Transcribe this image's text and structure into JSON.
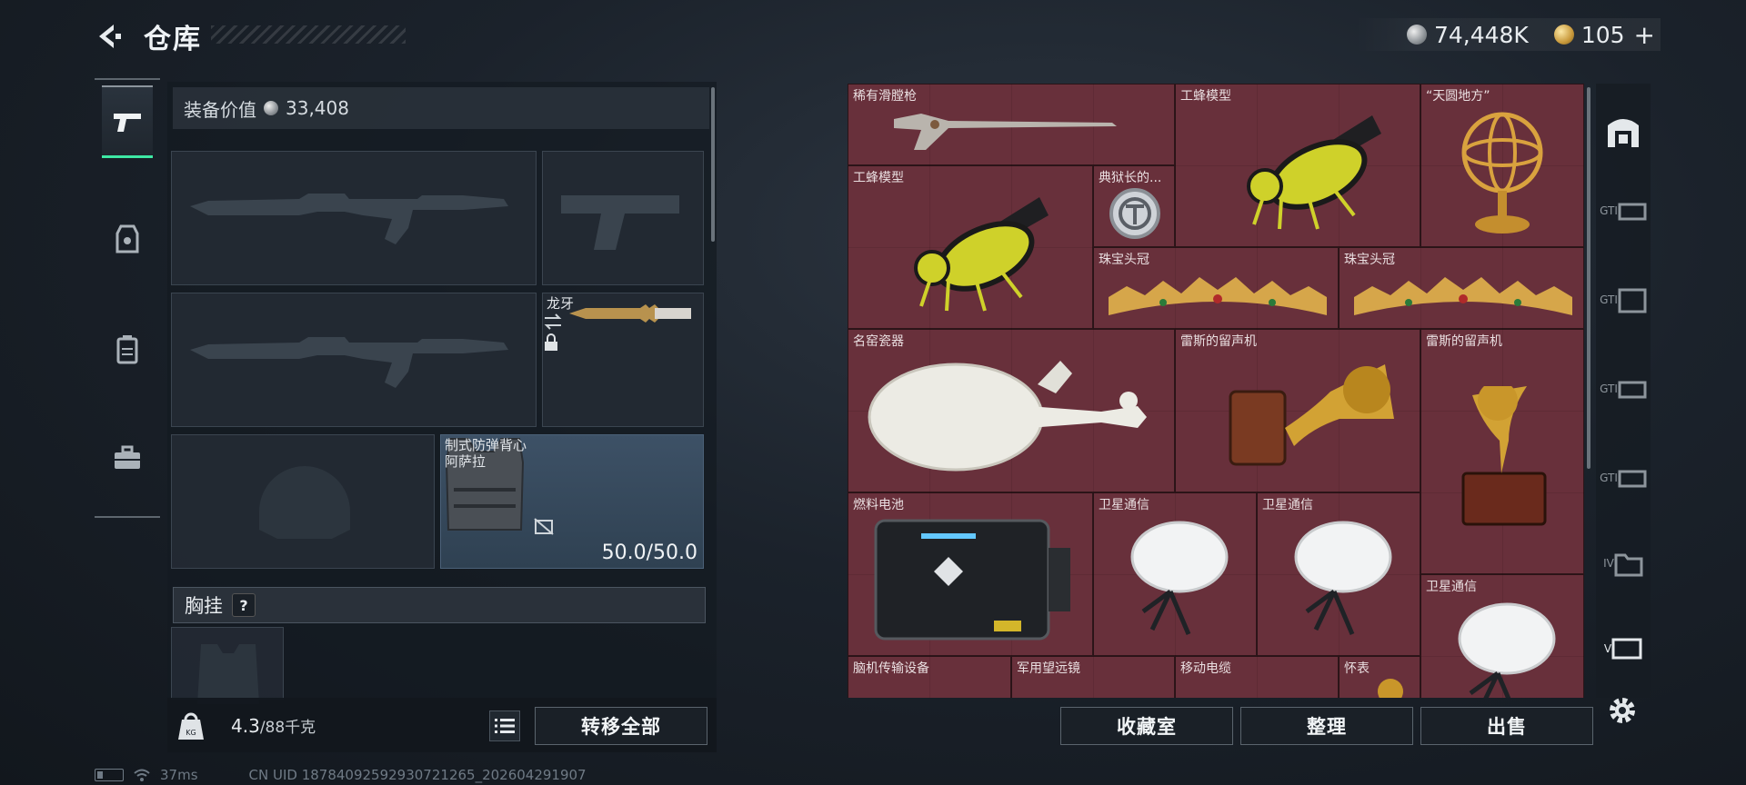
{
  "header": {
    "title": "仓库",
    "silver_amount": "74,448K",
    "gold_amount": "105",
    "add_symbol": "+"
  },
  "loadout": {
    "equip_value_label": "装备价值",
    "equip_value": "33,408",
    "knife_name": "龙牙",
    "vest_name": "制式防弹背心",
    "vest_subname": "阿萨拉",
    "vest_durability": "50.0/50.0",
    "chest_rig_label": "胸挂",
    "help_symbol": "?",
    "weight_current": "4.3",
    "weight_max": "/88千克",
    "transfer_all": "转移全部"
  },
  "storage": {
    "items": [
      {
        "name": "稀有滑膛枪"
      },
      {
        "name": "工蜂模型"
      },
      {
        "name": "“天圆地方”"
      },
      {
        "name": "工蜂模型"
      },
      {
        "name": "典狱长的..."
      },
      {
        "name": "珠宝头冠"
      },
      {
        "name": "珠宝头冠"
      },
      {
        "name": "名窑瓷器"
      },
      {
        "name": "雷斯的留声机"
      },
      {
        "name": "雷斯的留声机"
      },
      {
        "name": "燃料电池"
      },
      {
        "name": "卫星通信"
      },
      {
        "name": "卫星通信"
      },
      {
        "name": "卫星通信"
      },
      {
        "name": "脑机传输设备"
      },
      {
        "name": "军用望远镜"
      },
      {
        "name": "移动电缆"
      },
      {
        "name": "怀表"
      }
    ],
    "collection_button": "收藏室",
    "sort_button": "整理",
    "sell_button": "出售"
  },
  "side_tabs": {
    "tab2_label": "GTI",
    "tab3_label": "GTI",
    "tab4_label": "GTI",
    "tab5_label": "GTI",
    "tab6_label": "IV",
    "tab7_label": "V"
  },
  "status": {
    "ping": "37ms",
    "uid": "CN UID 18784092592930721265_202604291907"
  },
  "colors": {
    "accent": "#3ee8a4",
    "grid_bg": "#553038",
    "vest_bg": "#3d5166"
  }
}
